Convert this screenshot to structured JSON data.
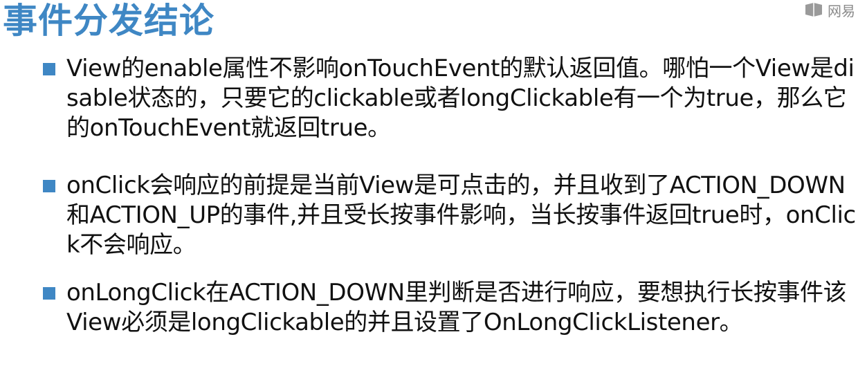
{
  "slide": {
    "title": "事件分发结论",
    "watermark_text": "网易",
    "bullets": [
      {
        "text": "View的enable属性不影响onTouchEvent的默认返回值。哪怕一个View是disable状态的，只要它的clickable或者longClickable有一个为true，那么它的onTouchEvent就返回true。"
      },
      {
        "text": "onClick会响应的前提是当前View是可点击的，并且收到了ACTION_DOWN和ACTION_UP的事件,并且受长按事件影响，当长按事件返回true时，onClick不会响应。"
      },
      {
        "text": "onLongClick在ACTION_DOWN里判断是否进行响应，要想执行长按事件该View必须是longClickable的并且设置了OnLongClickListener。"
      }
    ]
  },
  "colors": {
    "accent": "#3f87c4",
    "text": "#111111",
    "background": "#ffffff",
    "watermark": "#8a8a8a"
  }
}
